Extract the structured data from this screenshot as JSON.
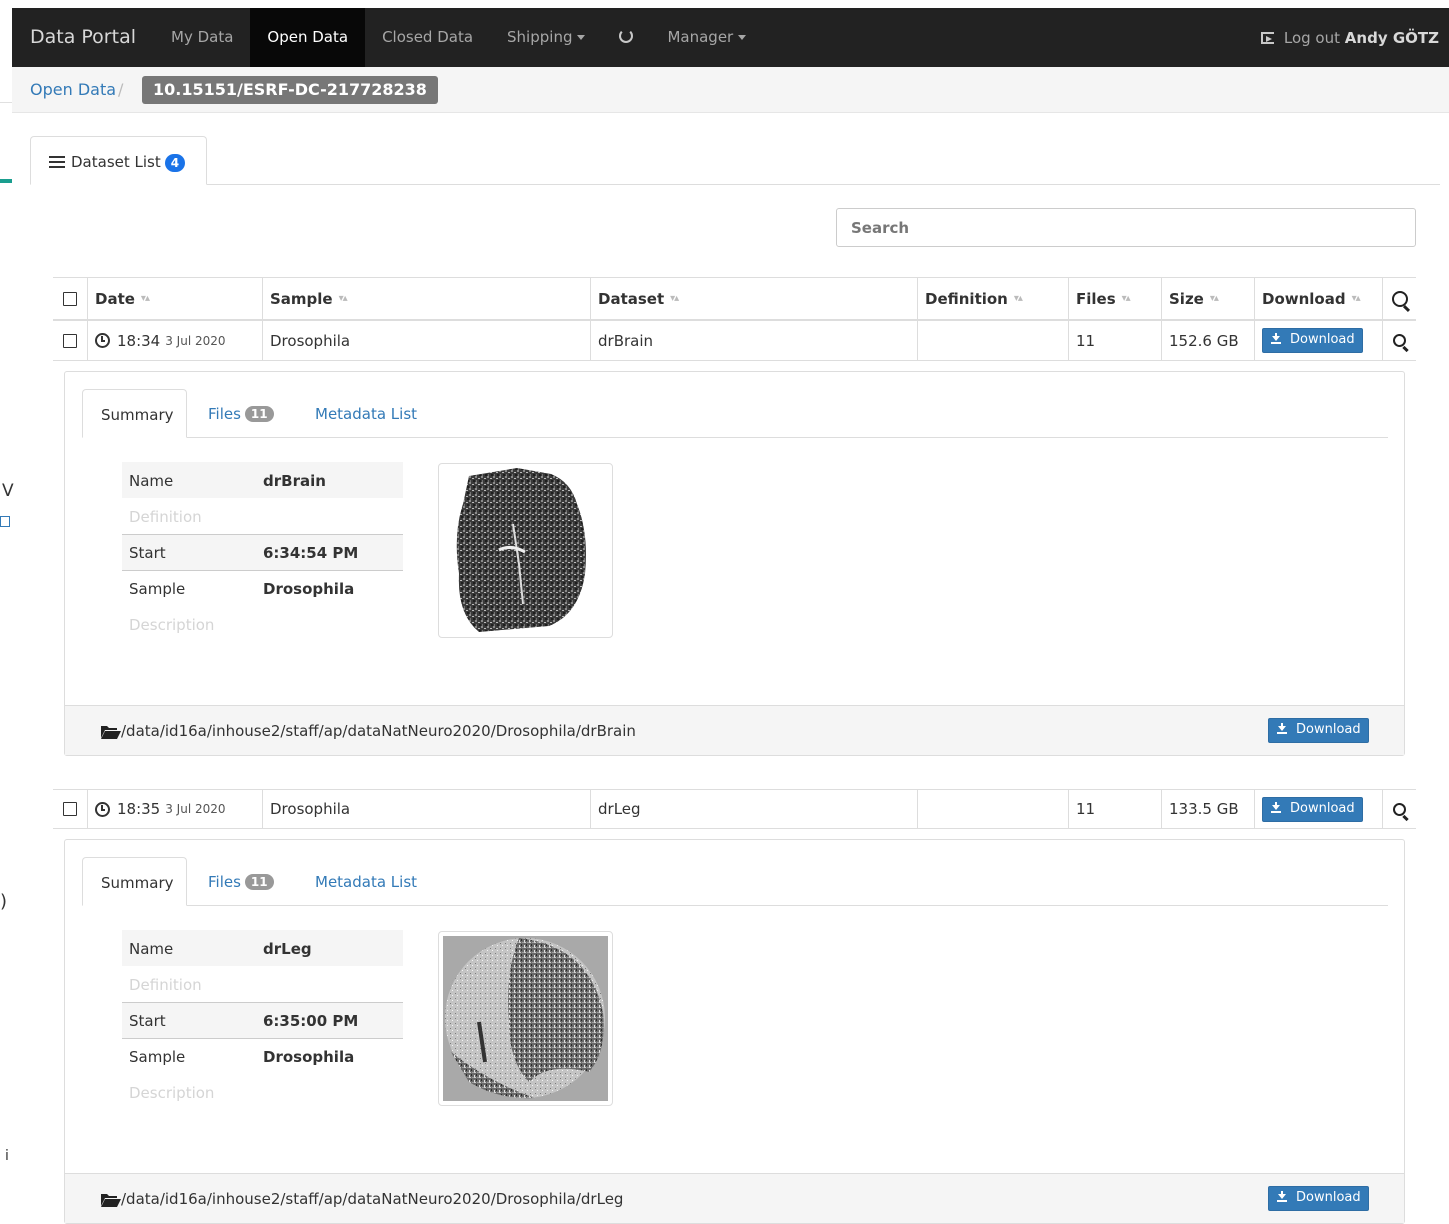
{
  "navbar": {
    "brand": "Data Portal",
    "items": [
      "My Data",
      "Open Data",
      "Closed Data",
      "Shipping",
      "Manager"
    ],
    "active": "Open Data",
    "logout_label": "Log out",
    "user": "Andy GÖTZ"
  },
  "breadcrumb": {
    "link": "Open Data",
    "separator": "/",
    "current": "10.15151/ESRF-DC-217728238"
  },
  "left_edge": {
    "chars": [
      "V",
      ")",
      "i"
    ]
  },
  "tabs": {
    "dataset_list": "Dataset List",
    "dataset_count": "4"
  },
  "search": {
    "placeholder": "Search"
  },
  "table": {
    "headers": [
      "Date",
      "Sample",
      "Dataset",
      "Definition",
      "Files",
      "Size",
      "Download"
    ],
    "sort_indicator": "▾▴",
    "download_label": "Download"
  },
  "datasets": [
    {
      "time": "18:34",
      "date": "3 Jul 2020",
      "sample": "Drosophila",
      "dataset": "drBrain",
      "definition": "",
      "files": "11",
      "size": "152.6 GB",
      "tabs": {
        "summary": "Summary",
        "files": "Files",
        "files_count": "11",
        "metadata": "Metadata List"
      },
      "summary": {
        "name_label": "Name",
        "name": "drBrain",
        "definition_label": "Definition",
        "start_label": "Start",
        "start": "6:34:54 PM",
        "sample_label": "Sample",
        "sample": "Drosophila",
        "description_label": "Description"
      },
      "path": "/data/id16a/inhouse2/staff/ap/dataNatNeuro2020/Drosophila/drBrain"
    },
    {
      "time": "18:35",
      "date": "3 Jul 2020",
      "sample": "Drosophila",
      "dataset": "drLeg",
      "definition": "",
      "files": "11",
      "size": "133.5 GB",
      "tabs": {
        "summary": "Summary",
        "files": "Files",
        "files_count": "11",
        "metadata": "Metadata List"
      },
      "summary": {
        "name_label": "Name",
        "name": "drLeg",
        "definition_label": "Definition",
        "start_label": "Start",
        "start": "6:35:00 PM",
        "sample_label": "Sample",
        "sample": "Drosophila",
        "description_label": "Description"
      },
      "path": "/data/id16a/inhouse2/staff/ap/dataNatNeuro2020/Drosophila/drLeg"
    }
  ],
  "colors": {
    "navbar": "#222222",
    "primary": "#337ab7",
    "badge": "#1a73e8",
    "accent_teal": "#1a9e8f"
  }
}
